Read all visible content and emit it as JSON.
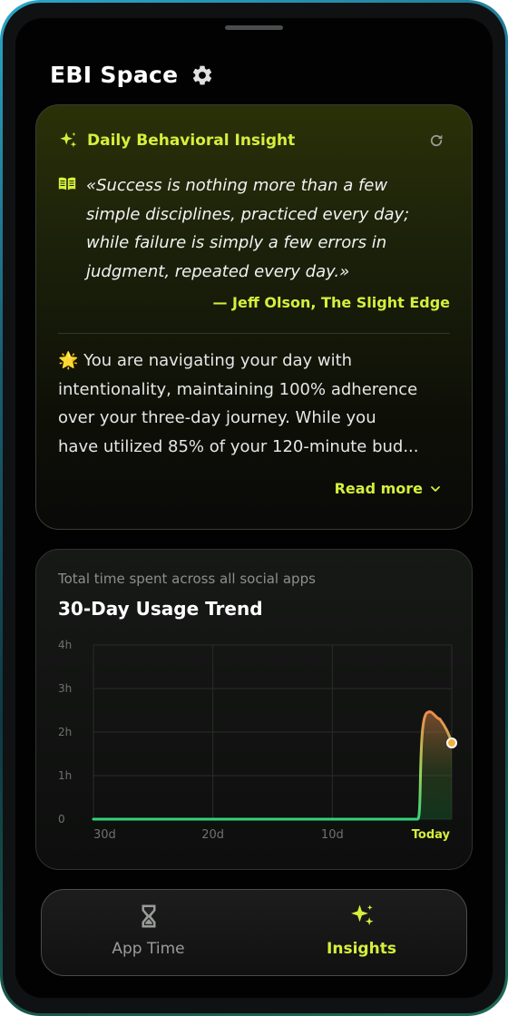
{
  "app": {
    "title": "EBI Space",
    "settings_icon": "gear-icon"
  },
  "insight": {
    "title": "Daily Behavioral Insight",
    "quote_lines": [
      "«Success is nothing more than a few",
      "simple disciplines, practiced every day;",
      "while failure is simply a few errors in",
      "judgment, repeated every day.»"
    ],
    "author": "— Jeff Olson, The Slight Edge",
    "body_lines": [
      "🌟 You are navigating your day with",
      "intentionality, maintaining 100% adherence",
      "over your three-day journey. While you",
      "have utilized 85% of your 120-minute bud..."
    ],
    "read_more": "Read more",
    "accent_color": "#d6ef3c"
  },
  "trend": {
    "subtitle": "Total time spent across all social apps",
    "title": "30-Day Usage Trend"
  },
  "chart_data": {
    "type": "area",
    "title": "30-Day Usage Trend",
    "ylabel": "",
    "xlabel": "",
    "y_ticks": [
      "0",
      "1h",
      "2h",
      "3h",
      "4h"
    ],
    "x_ticks": [
      "30d",
      "20d",
      "10d",
      "Today"
    ],
    "ylim": [
      0,
      4
    ],
    "x": [
      30,
      29,
      28,
      27,
      26,
      25,
      24,
      23,
      22,
      21,
      20,
      19,
      18,
      17,
      16,
      15,
      14,
      13,
      12,
      11,
      10,
      9,
      8,
      7,
      6,
      5,
      4,
      3,
      2,
      1,
      0
    ],
    "series": [
      {
        "values": [
          0,
          0,
          0,
          0,
          0,
          0,
          0,
          0,
          0,
          0,
          0,
          0,
          0,
          0,
          0,
          0,
          0,
          0,
          0,
          0,
          0,
          0,
          0,
          0,
          0,
          0,
          0,
          0,
          2.45,
          2.3,
          1.75
        ]
      }
    ],
    "grid": true,
    "colors": {
      "low": "#34d27a",
      "high": "#f08a4b"
    }
  },
  "nav": {
    "items": [
      {
        "label": "App Time",
        "icon": "hourglass-icon",
        "active": false
      },
      {
        "label": "Insights",
        "icon": "sparkles-icon",
        "active": true
      }
    ]
  }
}
